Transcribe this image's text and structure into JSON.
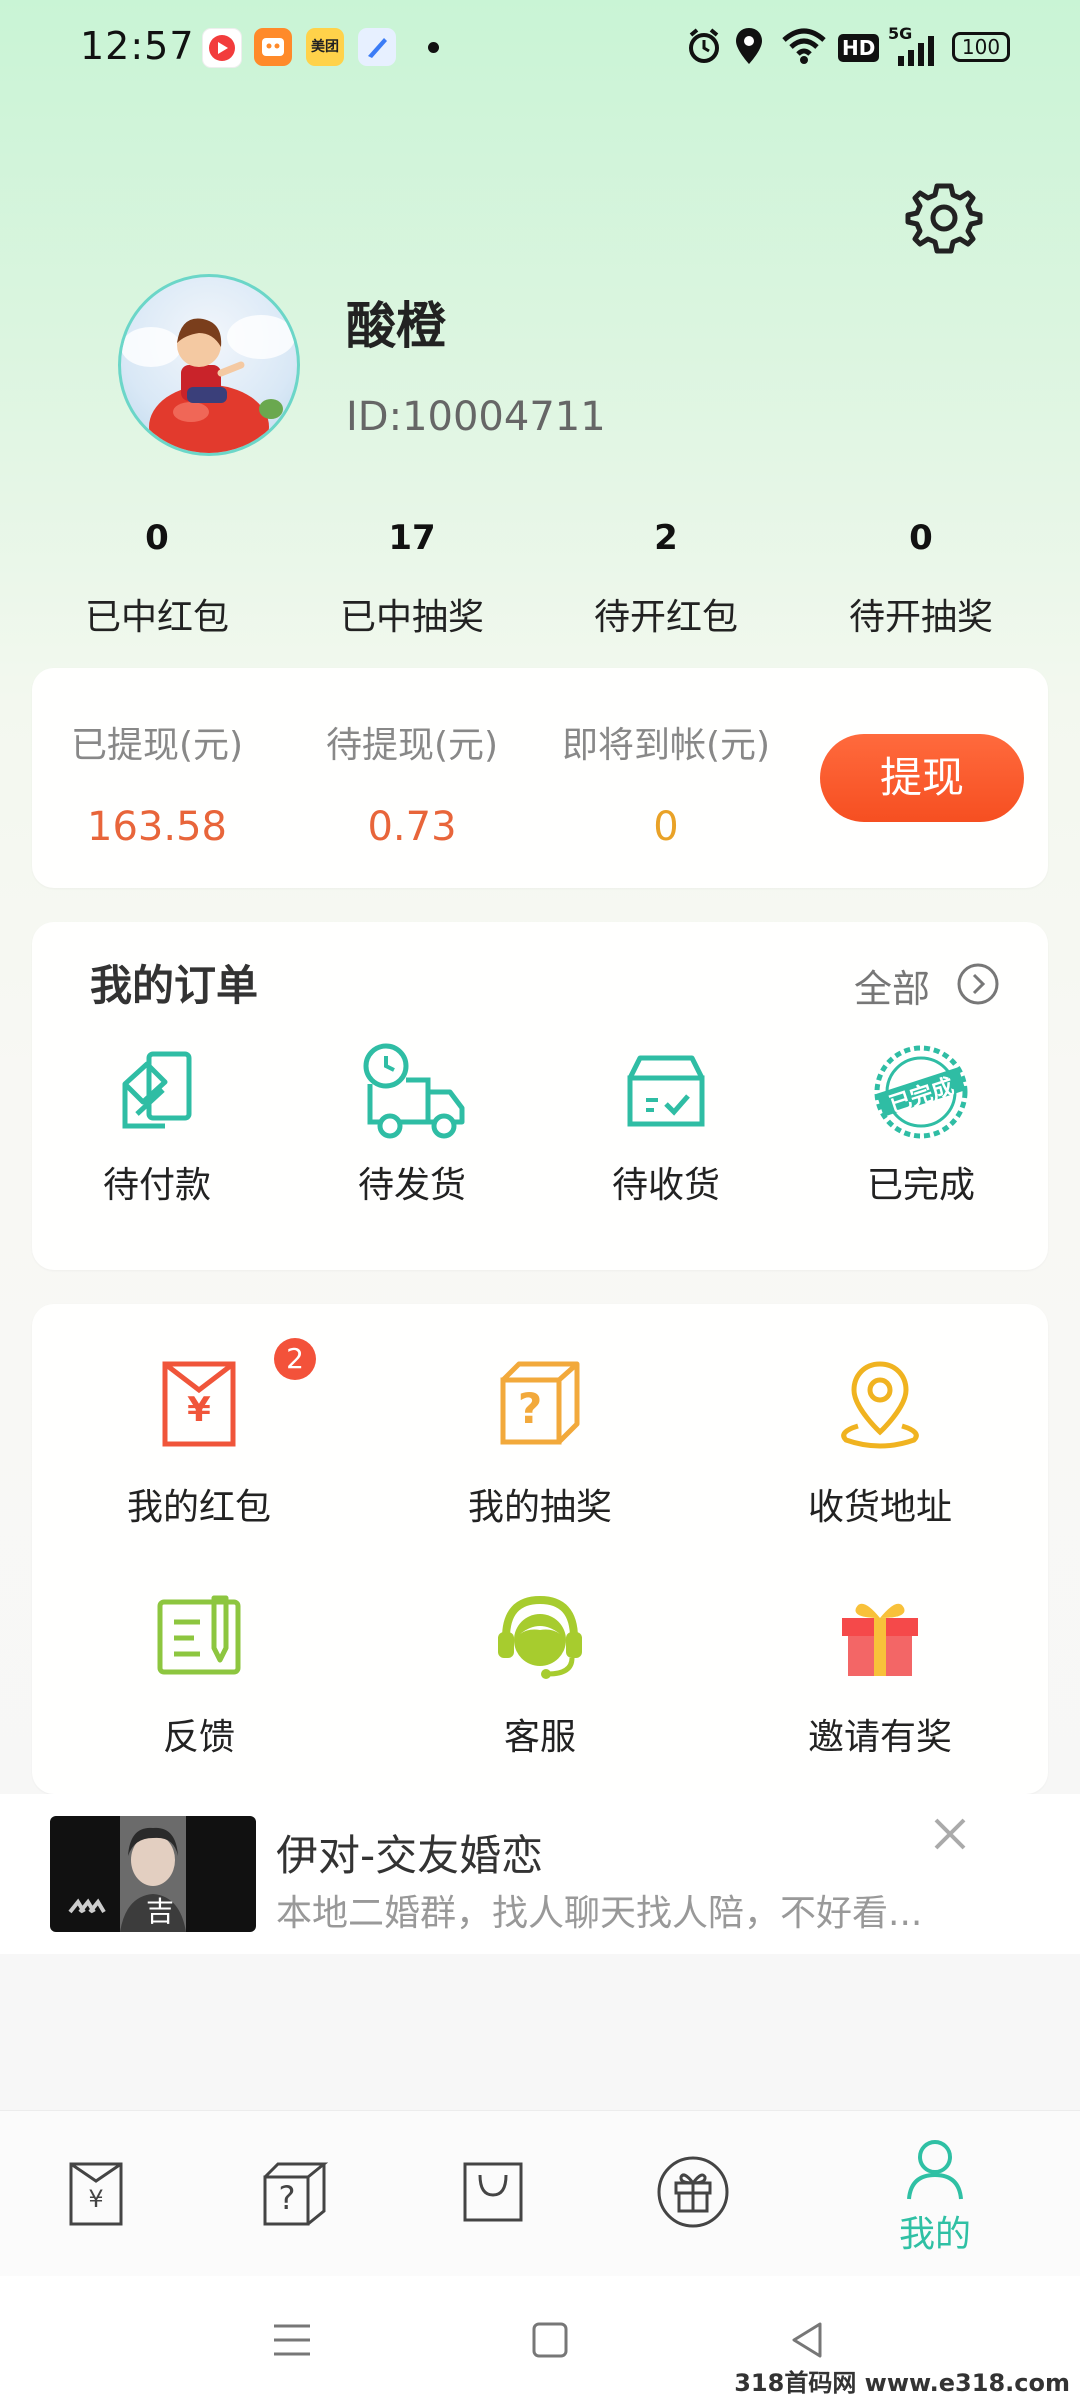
{
  "status_bar": {
    "time": "12:57",
    "network": "5G",
    "hd": "HD",
    "battery": "100",
    "app_icons": [
      "video-app-icon",
      "game-app-icon",
      "meituan-app-icon",
      "blue-app-icon"
    ],
    "meituan_label": "美团"
  },
  "profile": {
    "nickname": "酸橙",
    "user_id": "ID:10004711"
  },
  "stats": [
    {
      "value": "0",
      "label": "已中红包"
    },
    {
      "value": "17",
      "label": "已中抽奖"
    },
    {
      "value": "2",
      "label": "待开红包"
    },
    {
      "value": "0",
      "label": "待开抽奖"
    }
  ],
  "withdraw": {
    "items": [
      {
        "label": "已提现(元)",
        "value": "163.58",
        "color": "#e8653a"
      },
      {
        "label": "待提现(元)",
        "value": "0.73",
        "color": "#e8653a"
      },
      {
        "label": "即将到帐(元)",
        "value": "0",
        "color": "#e9a227"
      }
    ],
    "button": "提现"
  },
  "orders": {
    "title": "我的订单",
    "see_all": "全部",
    "items": [
      {
        "label": "待付款",
        "icon": "card-payment-icon"
      },
      {
        "label": "待发货",
        "icon": "delivery-truck-icon"
      },
      {
        "label": "待收货",
        "icon": "package-box-icon"
      },
      {
        "label": "已完成",
        "icon": "completed-stamp-icon"
      }
    ],
    "stamp_text": "已完成"
  },
  "services": {
    "items": [
      {
        "label": "我的红包",
        "icon": "red-envelope-icon",
        "badge": "2"
      },
      {
        "label": "我的抽奖",
        "icon": "mystery-box-icon"
      },
      {
        "label": "收货地址",
        "icon": "location-pin-icon"
      },
      {
        "label": "反馈",
        "icon": "feedback-note-icon"
      },
      {
        "label": "客服",
        "icon": "customer-service-icon"
      },
      {
        "label": "邀请有奖",
        "icon": "gift-box-icon"
      }
    ],
    "envelope_symbol": "¥",
    "box_symbol": "?"
  },
  "ad": {
    "title": "伊对-交友婚恋",
    "description": "本地二婚群，找人聊天找人陪，不好看...",
    "thumb_caption": "吉"
  },
  "tabs": [
    {
      "label": "",
      "icon": "red-envelope-tab-icon"
    },
    {
      "label": "",
      "icon": "mystery-box-tab-icon"
    },
    {
      "label": "",
      "icon": "shopping-bag-tab-icon"
    },
    {
      "label": "",
      "icon": "gift-tab-icon"
    },
    {
      "label": "我的",
      "icon": "profile-tab-icon",
      "active": true
    }
  ],
  "tab_symbols": {
    "envelope": "¥",
    "box": "?"
  },
  "colors": {
    "accent": "#2fc0a4",
    "orange": "#f65a2b",
    "badge": "#f3523a"
  },
  "watermark": "318首码网 www.e318.com"
}
